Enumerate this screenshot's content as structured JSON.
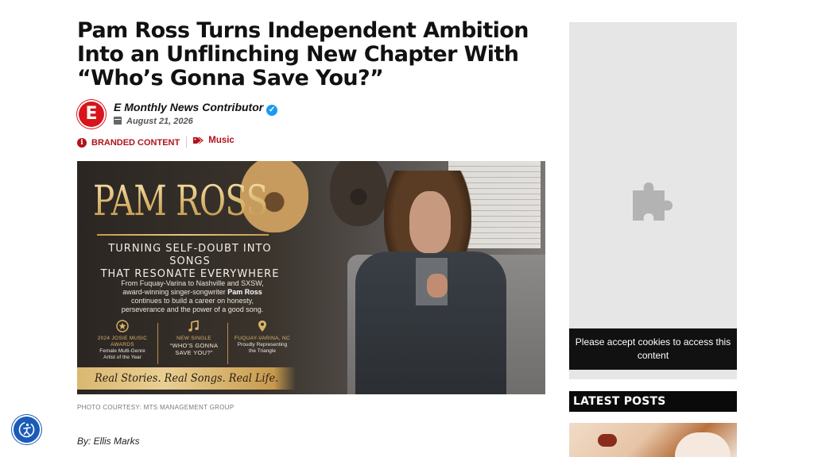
{
  "article": {
    "headline_line1": "Pam Ross Turns Independent Ambition",
    "headline_line2": "Into an Unflinching New Chapter With",
    "headline_line3": "“Who’s Gonna Save You?”",
    "avatar_letter": "E",
    "author": "E Monthly News Contributor",
    "date": "August 21, 2026",
    "tag_branded": "BRANDED CONTENT",
    "tag_music": "Music",
    "photo_credit": "PHOTO COURTESY: MTS MANAGEMENT GROUP",
    "byline": "By: Ellis Marks"
  },
  "hero": {
    "title": "PAM ROSS",
    "subtitle_line1": "TURNING SELF-DOUBT INTO SONGS",
    "subtitle_line2": "THAT RESONATE EVERYWHERE",
    "body_1": "From Fuquay-Varina to Nashville and SXSW,",
    "body_2_pre": "award-winning singer-songwriter ",
    "body_2_name": "Pam Ross",
    "body_3": "continues to build a career on honesty,",
    "body_4": "perseverance and the power of a good song.",
    "stats": [
      {
        "head": "2024 JOSIE MUSIC AWARDS",
        "sub1": "Female Multi-Genre",
        "sub2": "Artist of the Year"
      },
      {
        "head": "NEW SINGLE",
        "sub1": "“WHO’S GONNA",
        "sub2": "SAVE YOU?”"
      },
      {
        "head": "FUQUAY-VARINA, NC",
        "sub1": "Proudly Representing",
        "sub2": "the Triangle"
      }
    ],
    "banner": "Real Stories. Real Songs. Real Life."
  },
  "sidebar": {
    "cookie_message": "Please accept cookies to access this content",
    "latest_posts": "LATEST POSTS"
  },
  "colors": {
    "brand_red": "#d9141b",
    "tag_red": "#b3121a",
    "verified_blue": "#1d9bf0",
    "accessibility_blue": "#1a5bb8"
  },
  "icons": {
    "avatar": "e-monthly-logo",
    "verified": "verified-check-icon",
    "calendar": "calendar-icon",
    "branded": "info-icon",
    "music_tag": "tags-icon",
    "extension": "puzzle-piece-icon",
    "accessibility": "accessibility-icon"
  }
}
